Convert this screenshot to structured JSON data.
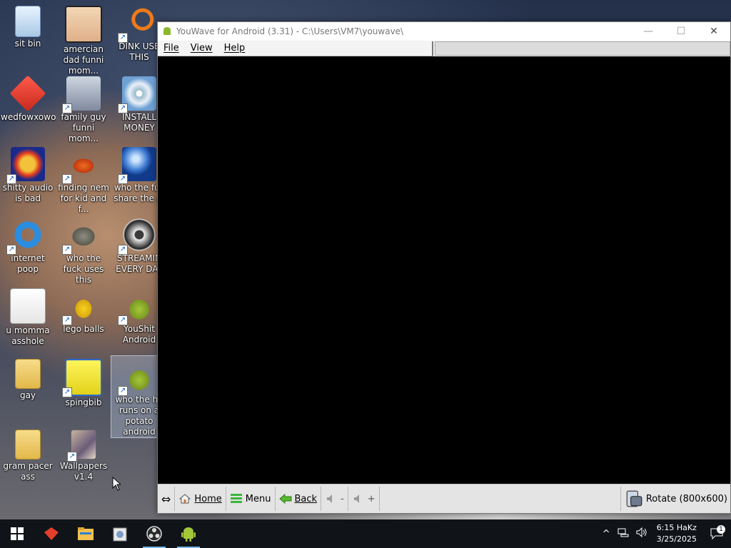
{
  "desktop": {
    "icons": [
      {
        "label": "sit bin",
        "icon": "recycle-bin-icon"
      },
      {
        "label": "amercian dad funni mom...",
        "icon": "cartoon-face-icon"
      },
      {
        "label": "DINK USE THIS",
        "icon": "search-magnifier-icon"
      },
      {
        "label": "wedfowxowo",
        "icon": "red-app-icon"
      },
      {
        "label": "family guy funni mom...",
        "icon": "kids-picture-icon"
      },
      {
        "label": "INSTALL MONEY",
        "icon": "installer-disc-icon"
      },
      {
        "label": "shitty audio is bad",
        "icon": "audio-app-icon"
      },
      {
        "label": "finding nem for kid and f...",
        "icon": "fish-icon"
      },
      {
        "label": "who the fuc share the pi",
        "icon": "globe-icon"
      },
      {
        "label": "internet poop",
        "icon": "internet-explorer-icon"
      },
      {
        "label": "who the fuck uses this",
        "icon": "gimp-icon"
      },
      {
        "label": "STREAMIN EVERY DAY",
        "icon": "obs-icon"
      },
      {
        "label": "u momma asshole",
        "icon": "ie-document-icon"
      },
      {
        "label": "lego balls",
        "icon": "lego-figure-icon"
      },
      {
        "label": "YouShit Android",
        "icon": "android-icon"
      },
      {
        "label": "gay",
        "icon": "folder-icon"
      },
      {
        "label": "spingbib",
        "icon": "spongebob-icon"
      },
      {
        "label": "who the he runs on a potato android",
        "icon": "android-icon"
      },
      {
        "label": "gram pacer ass",
        "icon": "folder-icon"
      },
      {
        "label": "Wallpapers v1.4",
        "icon": "wallpapers-icon"
      }
    ]
  },
  "window": {
    "title": "YouWave for Android (3.31) - C:\\Users\\VM7\\youwave\\",
    "controls": {
      "minimize": "—",
      "maximize": "☐",
      "close": "✕"
    },
    "menu": [
      "File",
      "View",
      "Help"
    ],
    "toolbar": {
      "resize_glyph": "⇔",
      "home": "Home",
      "menu": "Menu",
      "back": "Back",
      "vol_down": "-",
      "vol_up": "+",
      "rotate": "Rotate (800x600)"
    }
  },
  "taskbar": {
    "apps": [
      "windows-start-icon",
      "red-app-icon",
      "file-explorer-icon",
      "installer-icon",
      "obs-icon",
      "android-icon"
    ],
    "tray_chevron": "^",
    "time": "6:15 HaKz",
    "date": "3/25/2025",
    "notification_count": "1"
  },
  "colors": {
    "taskbar_bg": "#101418",
    "window_bg": "#000000",
    "toolbar_bg": "#e4e4e4",
    "accent": "#76b9ed"
  }
}
